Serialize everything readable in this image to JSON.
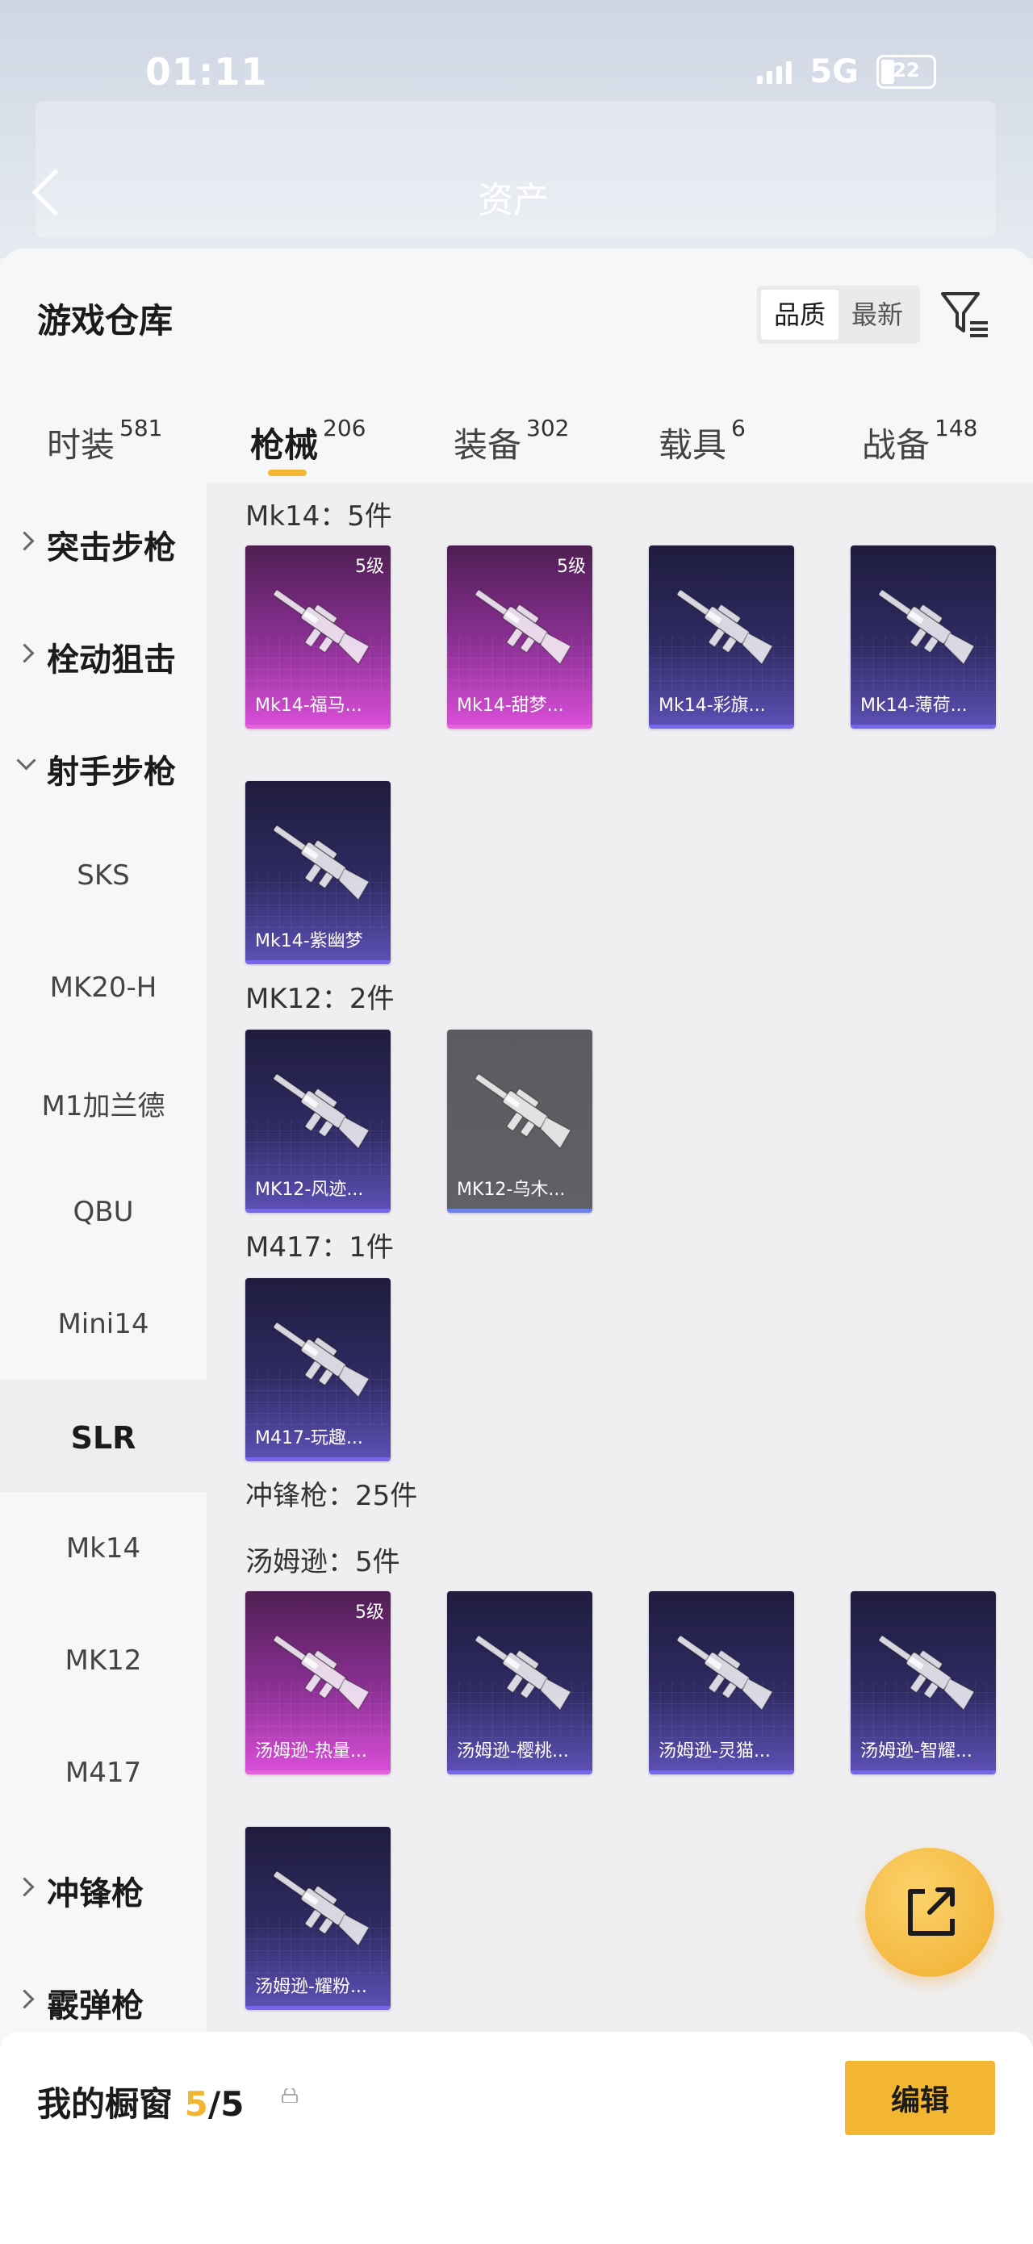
{
  "status_bar": {
    "time": "01:11",
    "network": "5G",
    "battery": "22"
  },
  "background_page": {
    "title": "资产"
  },
  "sheet": {
    "title": "游戏仓库",
    "sort_options": [
      {
        "label": "品质",
        "active": true
      },
      {
        "label": "最新",
        "active": false
      }
    ]
  },
  "tabs": [
    {
      "label": "时装",
      "count": "581"
    },
    {
      "label": "枪械",
      "count": "206",
      "active": true
    },
    {
      "label": "装备",
      "count": "302"
    },
    {
      "label": "载具",
      "count": "6"
    },
    {
      "label": "战备",
      "count": "148"
    }
  ],
  "sidebar": {
    "categories": [
      {
        "label": "突击步枪"
      },
      {
        "label": "栓动狙击"
      },
      {
        "label": "射手步枪"
      },
      {
        "label": "冲锋枪"
      },
      {
        "label": "霰弹枪"
      }
    ],
    "subitems": [
      "SKS",
      "MK20-H",
      "M1加兰德",
      "QBU",
      "Mini14",
      "SLR",
      "Mk14",
      "MK12",
      "M417"
    ],
    "selected": "SLR"
  },
  "groups": [
    {
      "label": "Mk14：5件",
      "items": [
        {
          "name": "Mk14-福马...",
          "level": "5级",
          "rarity": "pink"
        },
        {
          "name": "Mk14-甜梦...",
          "level": "5级",
          "rarity": "pink"
        },
        {
          "name": "Mk14-彩旗...",
          "rarity": "purple"
        },
        {
          "name": "Mk14-薄荷...",
          "rarity": "purple"
        },
        {
          "name": "Mk14-紫幽梦",
          "rarity": "purple"
        }
      ]
    },
    {
      "label": "MK12：2件",
      "items": [
        {
          "name": "MK12-风迹...",
          "rarity": "purple"
        },
        {
          "name": "MK12-乌木...",
          "rarity": "gray"
        }
      ]
    },
    {
      "label": "M417：1件",
      "items": [
        {
          "name": "M417-玩趣...",
          "rarity": "purple"
        }
      ]
    },
    {
      "label": "冲锋枪：25件"
    },
    {
      "label": "汤姆逊：5件",
      "items": [
        {
          "name": "汤姆逊-热量...",
          "level": "5级",
          "rarity": "pink"
        },
        {
          "name": "汤姆逊-樱桃...",
          "rarity": "purple"
        },
        {
          "name": "汤姆逊-灵猫...",
          "rarity": "purple"
        },
        {
          "name": "汤姆逊-智耀...",
          "rarity": "purple"
        },
        {
          "name": "汤姆逊-耀粉...",
          "rarity": "purple"
        }
      ]
    }
  ],
  "showcase": {
    "label": "我的橱窗",
    "current": "5",
    "total": "/5",
    "edit_label": "编辑"
  },
  "icons": {
    "filter": "filter-list-icon",
    "share": "share-external-icon",
    "lock": "lock-icon",
    "back": "back-chevron-icon"
  },
  "colors": {
    "accent": "#f2b632",
    "rarity_pink": "#e661dd",
    "rarity_purple": "#7667e6"
  }
}
